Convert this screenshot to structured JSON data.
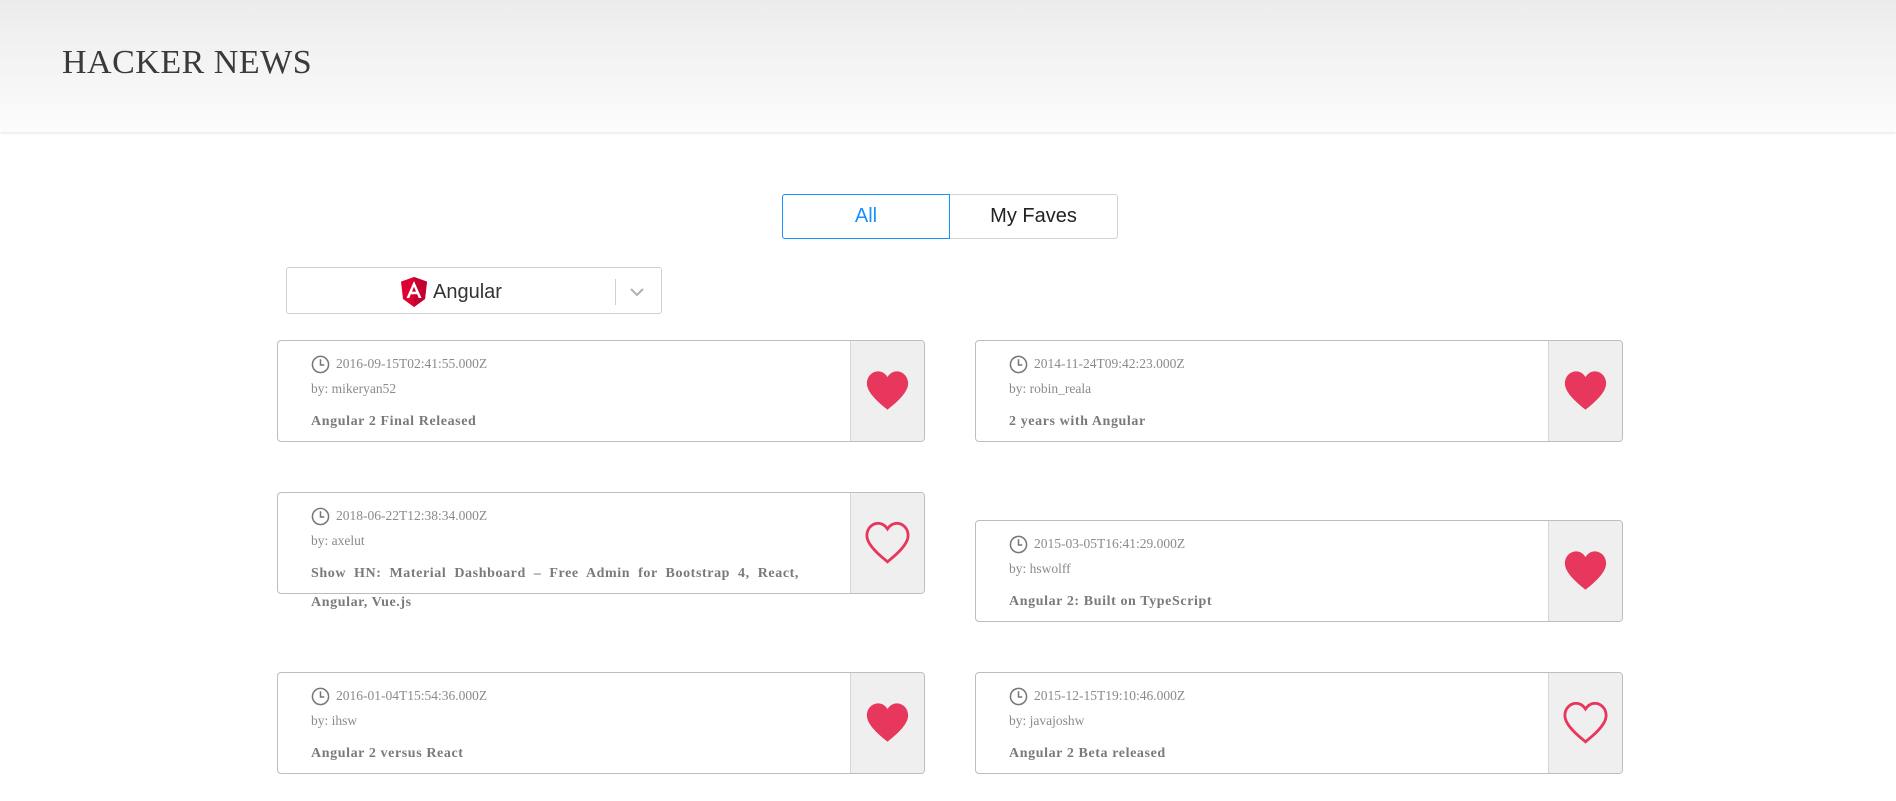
{
  "header": {
    "title": "HACKER NEWS"
  },
  "tabs": [
    {
      "label": "All"
    },
    {
      "label": "My Faves"
    }
  ],
  "framework_select": {
    "selected": "Angular"
  },
  "colors": {
    "accent": "#1890ff",
    "heart": "#e8375c"
  },
  "cards": [
    {
      "time": "2016-09-15T02:41:55.000Z",
      "author": "by: mikeryan52",
      "title": "Angular 2 Final Released",
      "favorited": true
    },
    {
      "time": "2014-11-24T09:42:23.000Z",
      "author": "by: robin_reala",
      "title": "2 years with Angular",
      "favorited": true
    },
    {
      "time": "2018-06-22T12:38:34.000Z",
      "author": "by: axelut",
      "title": "Show HN: Material Dashboard – Free Admin for Bootstrap 4, React, Angular, Vue.js",
      "favorited": false
    },
    {
      "time": "2015-03-05T16:41:29.000Z",
      "author": "by: hswolff",
      "title": "Angular 2: Built on TypeScript",
      "favorited": true
    },
    {
      "time": "2016-01-04T15:54:36.000Z",
      "author": "by: ihsw",
      "title": "Angular 2 versus React",
      "favorited": true
    },
    {
      "time": "2015-12-15T19:10:46.000Z",
      "author": "by: javajoshw",
      "title": "Angular 2 Beta released",
      "favorited": false
    }
  ]
}
